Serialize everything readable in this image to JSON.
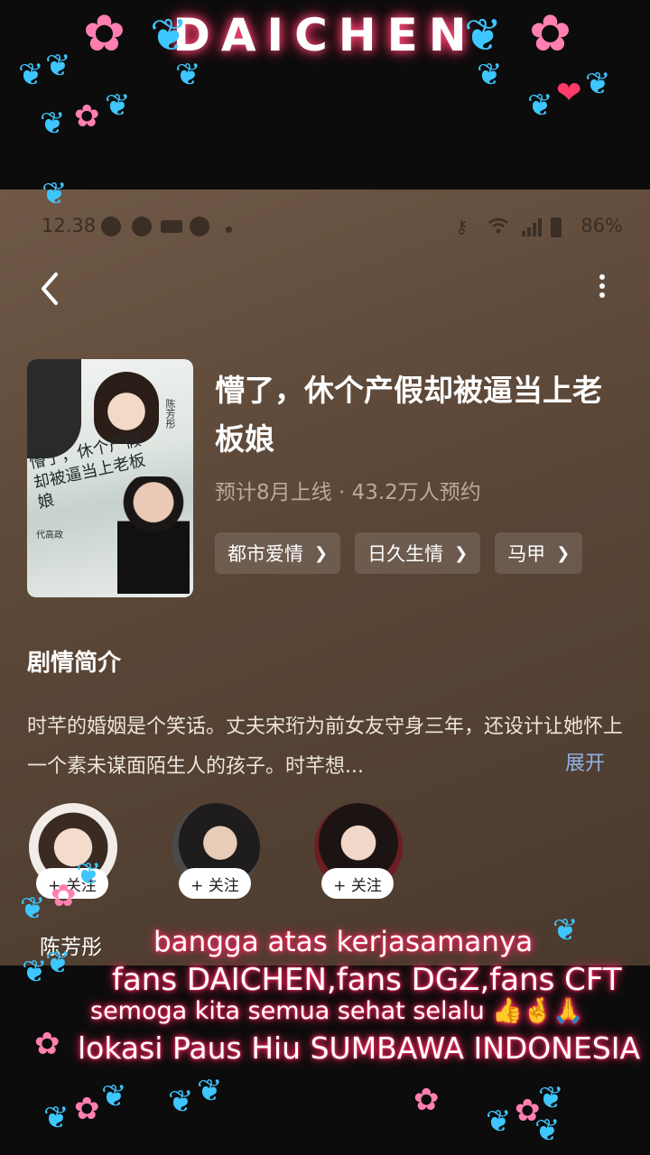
{
  "overlay": {
    "title": "DAICHEN",
    "captions": [
      "bangga atas kerjasamanya",
      "fans DAICHEN,fans DGZ,fans CFT",
      "semoga kita semua sehat selalu 👍🤞🙏",
      "lokasi Paus Hiu SUMBAWA INDONESIA"
    ],
    "glow_color": "#ff2a5f"
  },
  "status_bar": {
    "time": "12.38",
    "battery": "86%",
    "icons": [
      "chat-icon",
      "play-icon",
      "iqiyi-icon",
      "notification-icon",
      "key-icon",
      "wifi-icon",
      "signal-icon",
      "battery-icon"
    ]
  },
  "nav": {
    "back_icon": "chevron-left-icon",
    "menu_icon": "more-vertical-icon"
  },
  "drama": {
    "poster": {
      "title": "懵了，休个产假却被逼当上老板娘",
      "actor_right": "陈芳彤",
      "actor_bottom": "代高政"
    },
    "title": "懵了，休个产假却被逼当上老板娘",
    "meta": "预计8月上线 · 43.2万人预约",
    "tags": [
      "都市爱情",
      "日久生情",
      "马甲"
    ]
  },
  "synopsis": {
    "heading": "剧情简介",
    "text": "时芊的婚姻是个笑话。丈夫宋珩为前女友守身三年，还设计让她怀上一个素未谋面陌生人的孩子。时芊想...",
    "expand_label": "展开"
  },
  "cast": {
    "follow_label": "+ 关注",
    "members": [
      {
        "name": "陈芳彤"
      },
      {
        "name": ""
      },
      {
        "name": ""
      }
    ]
  },
  "colors": {
    "background": "#5a4637",
    "accent_link": "#8fb2e8",
    "meta_text": "#b9aa9c"
  }
}
